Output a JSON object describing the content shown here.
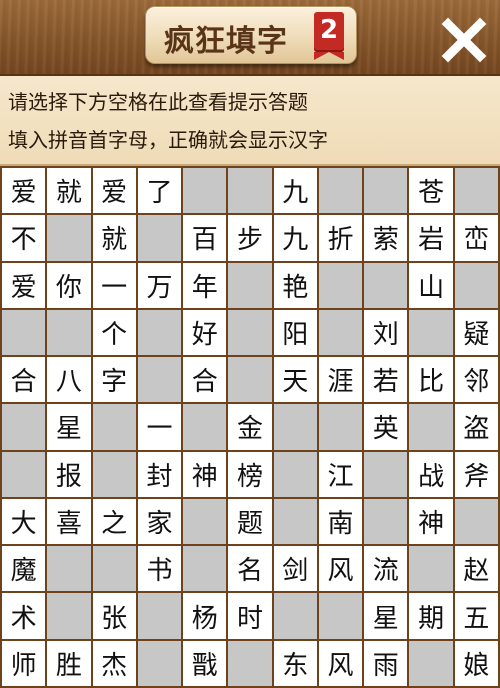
{
  "header": {
    "title": "疯狂填字",
    "level": "2",
    "close_icon": "close-icon"
  },
  "hints": {
    "line1": "请选择下方空格在此查看提示答题",
    "line2": "填入拼音首字母，正确就会显示汉字"
  },
  "colors": {
    "wood": "#7a4a22",
    "panel": "#f3e2c4",
    "badge": "#c42a24",
    "empty_cell": "#c7c7c7",
    "filled_cell": "#ffffff"
  },
  "grid": {
    "rows": [
      [
        "爱",
        "就",
        "爱",
        "了",
        "",
        "",
        "九",
        "",
        "",
        "苍",
        ""
      ],
      [
        "不",
        "",
        "就",
        "",
        "百",
        "步",
        "九",
        "折",
        "萦",
        "岩",
        "峦"
      ],
      [
        "爱",
        "你",
        "一",
        "万",
        "年",
        "",
        "艳",
        "",
        "",
        "山",
        ""
      ],
      [
        "",
        "",
        "个",
        "",
        "好",
        "",
        "阳",
        "",
        "刘",
        "",
        "疑"
      ],
      [
        "合",
        "八",
        "字",
        "",
        "合",
        "",
        "天",
        "涯",
        "若",
        "比",
        "邻"
      ],
      [
        "",
        "星",
        "",
        "一",
        "",
        "金",
        "",
        "",
        "英",
        "",
        "盗"
      ],
      [
        "",
        "报",
        "",
        "封",
        "神",
        "榜",
        "",
        "江",
        "",
        "战",
        "斧"
      ],
      [
        "大",
        "喜",
        "之",
        "家",
        "",
        "题",
        "",
        "南",
        "",
        "神",
        ""
      ],
      [
        "魔",
        "",
        "",
        "书",
        "",
        "名",
        "剑",
        "风",
        "流",
        "",
        "赵"
      ],
      [
        "术",
        "",
        "张",
        "",
        "杨",
        "时",
        "",
        "",
        "星",
        "期",
        "五"
      ],
      [
        "师",
        "胜",
        "杰",
        "",
        "戬",
        "",
        "东",
        "风",
        "雨",
        "",
        "娘"
      ]
    ]
  }
}
